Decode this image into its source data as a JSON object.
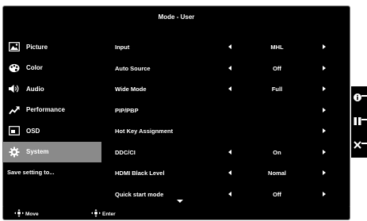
{
  "osd": {
    "title": "Mode - User",
    "menu": [
      {
        "label": "Picture",
        "icon": "picture-icon",
        "active": false
      },
      {
        "label": "Color",
        "icon": "palette-icon",
        "active": false
      },
      {
        "label": "Audio",
        "icon": "speaker-icon",
        "active": false
      },
      {
        "label": "Performance",
        "icon": "trend-up-icon",
        "active": false
      },
      {
        "label": "OSD",
        "icon": "monitor-icon",
        "active": false
      },
      {
        "label": "System",
        "icon": "gear-icon",
        "active": true
      }
    ],
    "save_setting": "Save setting to...",
    "settings": [
      {
        "label": "Input",
        "value": "MHL",
        "left_arrow": true
      },
      {
        "label": "Auto Source",
        "value": "Off",
        "left_arrow": true
      },
      {
        "label": "Wide Mode",
        "value": "Full",
        "left_arrow": true
      },
      {
        "label": "PIP/PBP",
        "value": "",
        "left_arrow": false
      },
      {
        "label": "Hot Key Assignment",
        "value": "",
        "left_arrow": false
      },
      {
        "label": "DDC/CI",
        "value": "On",
        "left_arrow": true
      },
      {
        "label": "HDMI Black Level",
        "value": "Nomal",
        "left_arrow": true
      },
      {
        "label": "Quick start mode",
        "value": "Off",
        "left_arrow": true
      }
    ]
  },
  "footer": {
    "move_label": "Move",
    "enter_label": "Enter"
  },
  "side_buttons": [
    {
      "icon": "info-icon"
    },
    {
      "icon": "pause-icon"
    },
    {
      "icon": "close-icon"
    }
  ],
  "colors": {
    "background": "#000000",
    "selected": "#8a8a8a",
    "text": "#ffffff"
  }
}
